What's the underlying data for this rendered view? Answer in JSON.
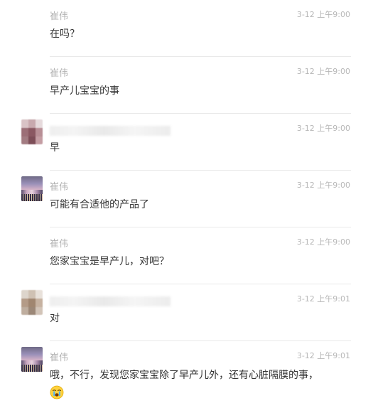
{
  "messages": [
    {
      "name": "崔伟",
      "time": "3-12 上午9:00",
      "text": "在吗？",
      "avatar": "none"
    },
    {
      "name": "崔伟",
      "time": "3-12 上午9:00",
      "text": "早产儿宝宝的事",
      "avatar": "none"
    },
    {
      "name": "",
      "time": "3-12 上午9:00",
      "text": "早",
      "avatar": "pixelated-avatar"
    },
    {
      "name": "崔伟",
      "time": "3-12 上午9:00",
      "text": "可能有合适他的产品了",
      "avatar": "city-night-photo"
    },
    {
      "name": "崔伟",
      "time": "3-12 上午9:00",
      "text": "您家宝宝是早产儿，对吧？",
      "avatar": "none"
    },
    {
      "name": "",
      "time": "3-12 上午9:01",
      "text": "对",
      "avatar": "pixelated-avatar"
    },
    {
      "name": "崔伟",
      "time": "3-12 上午9:01",
      "text": "哦，不行，发现您家宝宝除了早产儿外，还有心脏隔膜的事，",
      "avatar": "city-night-photo",
      "emoji": "crying-emoji-icon"
    }
  ]
}
